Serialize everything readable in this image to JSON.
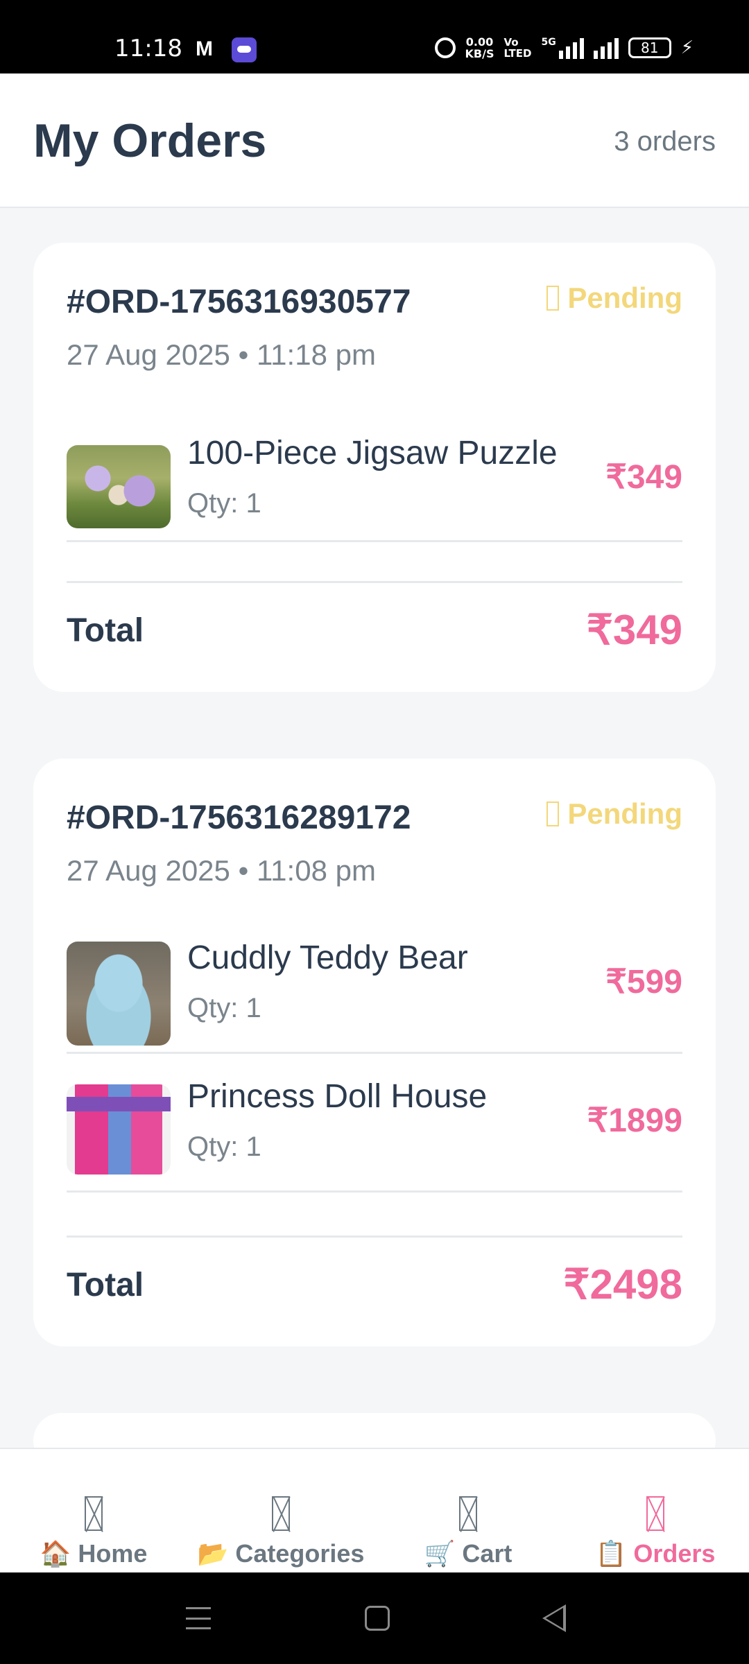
{
  "status_bar": {
    "time": "11:18",
    "net_speed": "0.00",
    "net_unit": "KB/S",
    "volte_top": "Vo",
    "volte_bottom": "LTED",
    "network": "5G",
    "battery": "81"
  },
  "header": {
    "title": "My Orders",
    "order_count": "3 orders"
  },
  "orders": [
    {
      "id": "#ORD-1756316930577",
      "date": "27 Aug 2025 • 11:18 pm",
      "status": "Pending",
      "items": [
        {
          "name": "100-Piece Jigsaw Puzzle",
          "qty": "Qty: 1",
          "price": "₹349",
          "image": "jigsaw-puzzle-image"
        }
      ],
      "total_label": "Total",
      "total": "₹349"
    },
    {
      "id": "#ORD-1756316289172",
      "date": "27 Aug 2025 • 11:08 pm",
      "status": "Pending",
      "items": [
        {
          "name": "Cuddly Teddy Bear",
          "qty": "Qty: 1",
          "price": "₹599",
          "image": "teddy-bear-image"
        },
        {
          "name": "Princess Doll House",
          "qty": "Qty: 1",
          "price": "₹1899",
          "image": "doll-house-image"
        }
      ],
      "total_label": "Total",
      "total": "₹2498"
    }
  ],
  "nav": {
    "items": [
      {
        "label": "🏠 Home",
        "active": false
      },
      {
        "label": "📂 Categories",
        "active": false
      },
      {
        "label": "🛒 Cart",
        "active": false
      },
      {
        "label": "📋 Orders",
        "active": true
      }
    ]
  },
  "colors": {
    "accent": "#f06a9c",
    "status_pending": "#f3d77a",
    "title_text": "#2b3a4d",
    "muted_text": "#7a848c",
    "background": "#f4f6f8"
  }
}
